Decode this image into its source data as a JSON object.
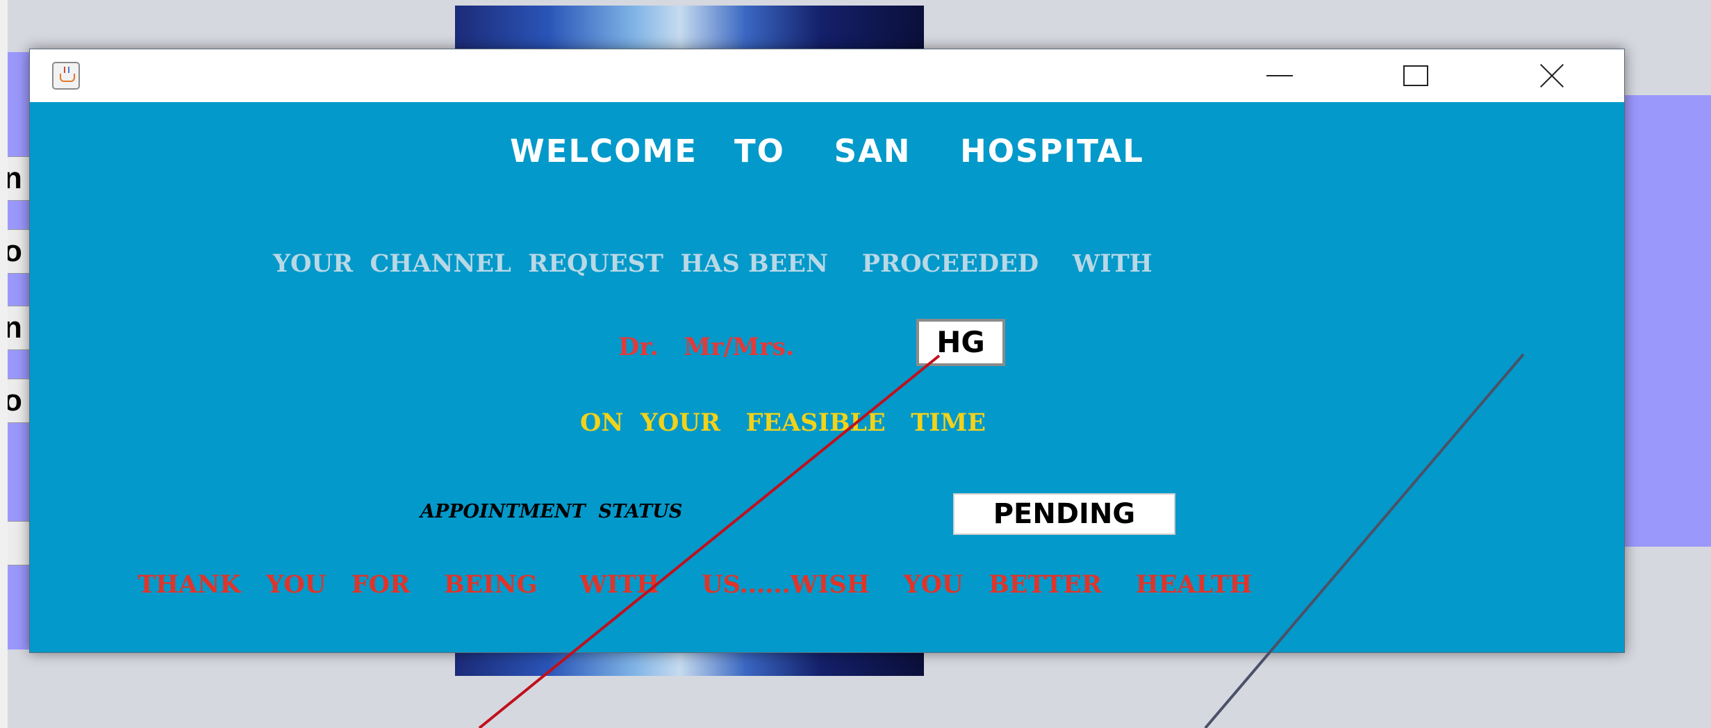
{
  "background": {
    "partial_buttons": [
      "n",
      "o",
      "n",
      "o",
      ""
    ]
  },
  "dialog": {
    "welcome": "WELCOME   TO    SAN    HOSPITAL",
    "request_text": "YOUR  CHANNEL  REQUEST  HAS BEEN    PROCEEDED    WITH",
    "doctor_label": "Dr.   Mr/Mrs.",
    "doctor_value": "HG",
    "feasible_text": "ON  YOUR   FEASIBLE   TIME",
    "status_label": "APPOINTMENT  STATUS",
    "status_value": "PENDING",
    "thanks_text": "THANK   YOU   FOR    BEING     WITH     US......WISH    YOU   BETTER    HEALTH"
  },
  "colors": {
    "dialog_bg": "#0399ca",
    "annotation_line_1": "#c0101c",
    "annotation_line_2": "#4a5168"
  },
  "icons": [
    "java-app-icon",
    "minimize-icon",
    "maximize-icon",
    "close-icon"
  ]
}
